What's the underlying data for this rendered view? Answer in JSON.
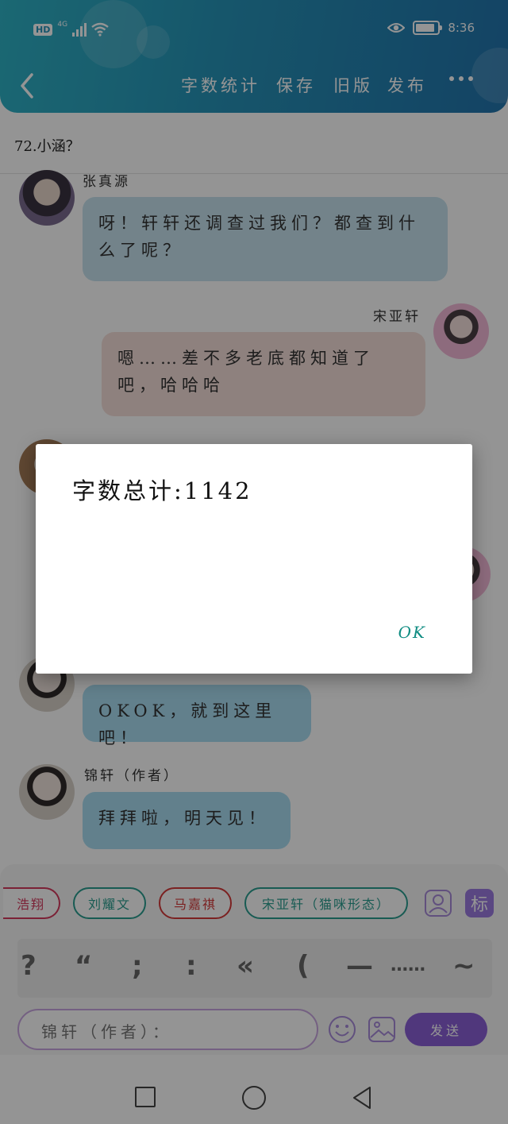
{
  "status_bar": {
    "hd": "HD",
    "network": "4G",
    "time": "8:36"
  },
  "header": {
    "menu": [
      "字数统计",
      "保存",
      "旧版",
      "发布"
    ]
  },
  "chapter_title": "72.小涵？",
  "chat": {
    "messages": [
      {
        "speaker": "张真源",
        "text": "呀！轩轩还调查过我们？都查到什么了呢？"
      },
      {
        "speaker": "宋亚轩",
        "text": "嗯……差不多老底都知道了吧，哈哈哈"
      },
      {
        "speaker": "",
        "text": "OKOK，就到这里吧！"
      },
      {
        "speaker": "锦轩（作者）",
        "text": "拜拜啦，明天见！"
      }
    ]
  },
  "editor": {
    "chips": [
      {
        "label": "浩翔",
        "color": "#d43a5e"
      },
      {
        "label": "刘耀文",
        "color": "#2a9d8f"
      },
      {
        "label": "马嘉祺",
        "color": "#d43a3a"
      },
      {
        "label": "宋亚轩（猫咪形态）",
        "color": "#2a9d8f"
      }
    ],
    "tag_label": "标",
    "punctuation": [
      "?",
      "“",
      ";",
      ":",
      "«",
      "(",
      "—",
      "……",
      "~"
    ],
    "input_placeholder": "锦轩（作者）：",
    "send_label": "发送"
  },
  "dialog": {
    "message": "字数总计:1142",
    "ok_label": "OK"
  }
}
